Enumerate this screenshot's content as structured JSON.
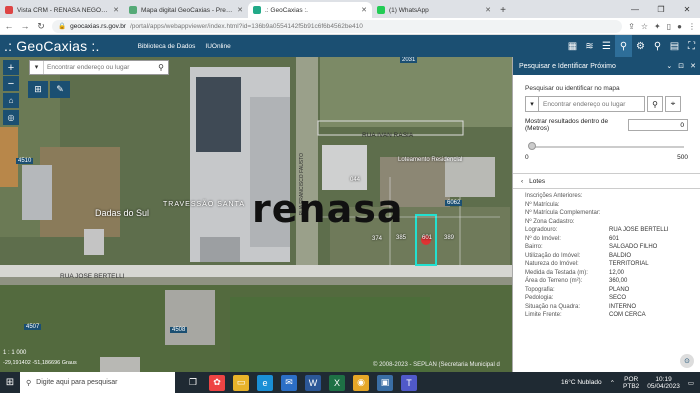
{
  "browser": {
    "tabs": [
      {
        "title": "Vista CRM - RENASA NEGÓCIOS",
        "favicon_color": "#d44",
        "active": false
      },
      {
        "title": "Mapa digital GeoCaxias - Prefeitu",
        "favicon_color": "#5a7",
        "active": false
      },
      {
        "title": ".: GeoCaxias :.",
        "favicon_color": "#2a8",
        "active": true
      },
      {
        "title": "(1) WhatsApp",
        "favicon_color": "#2c5",
        "active": false
      }
    ],
    "url_domain": "geocaxias.rs.gov.br",
    "url_path": "/portal/apps/webappviewer/index.html?id=136b9a0554142f5b91c6f6b4562be410",
    "new_tab": "+",
    "window_controls": [
      "—",
      "❐",
      "✕"
    ]
  },
  "app": {
    "logo": ".: GeoCaxias :.",
    "links": [
      "Biblioteca de Dados",
      "IUOnline"
    ],
    "tools": [
      "▦",
      "≋",
      "☰",
      "⚲",
      "⚙",
      "⚲",
      "▤",
      "⛶"
    ]
  },
  "map": {
    "search_placeholder": "Encontrar endereço ou lugar",
    "zoom_in": "+",
    "zoom_out": "−",
    "scale": "1 : 1 000",
    "coordinates": "-29,191402  -51,186696 Graus",
    "copyright": "© 2008-2023 - SEPLAN (Secretaria Municipal d",
    "street_labels": [
      "RUA IVAN RASIA",
      "RUA JOSE BERTELLI",
      "RUA FRANCISCO FAUSTO"
    ],
    "lot_numbers": [
      "2031",
      "4510",
      "6062",
      "4507",
      "4508"
    ],
    "area_labels": [
      "TRAVESSÃO SANTA",
      "Dadas do Sul"
    ],
    "watermark": "renasa",
    "parcel_labels": [
      "404",
      "044",
      "102",
      "Loteamento Residencial",
      "374",
      "601",
      "385",
      "389"
    ]
  },
  "panel": {
    "title": "Pesquisar e Identificar Próximo",
    "header_buttons": [
      "⌄",
      "⊡",
      "✕"
    ],
    "search_label": "Pesquisar ou identificar no mapa",
    "search_placeholder": "Encontrar endereço ou lugar",
    "distance_label": "Mostrar resultados dentro de (Metros)",
    "distance_value": "0",
    "slider_min": "0",
    "slider_max": "500",
    "results_title": "Lotes",
    "attributes": [
      {
        "key": "Inscrições Anteriores:",
        "value": ""
      },
      {
        "key": "Nº Matrícula:",
        "value": ""
      },
      {
        "key": "Nº Matrícula Complementar:",
        "value": ""
      },
      {
        "key": "Nº Zona Cadastro:",
        "value": ""
      },
      {
        "key": "Logradouro:",
        "value": "RUA JOSE BERTELLI"
      },
      {
        "key": "Nº do Imóvel:",
        "value": "601"
      },
      {
        "key": "Bairro:",
        "value": "SALGADO FILHO"
      },
      {
        "key": "Utilização do Imóvel:",
        "value": "BALDIO"
      },
      {
        "key": "Natureza do Imóvel:",
        "value": "TERRITORIAL"
      },
      {
        "key": "Medida da Testada (m):",
        "value": "12,00"
      },
      {
        "key": "Área do Terreno (m²):",
        "value": "360,00"
      },
      {
        "key": "Topografia:",
        "value": "PLANO"
      },
      {
        "key": "Pedologia:",
        "value": "SECO"
      },
      {
        "key": "Situação na Quadra:",
        "value": "INTERNO"
      },
      {
        "key": "Limite Frente:",
        "value": "COM CERCA"
      }
    ]
  },
  "taskbar": {
    "search_placeholder": "Digite aqui para pesquisar",
    "weather": "16°C  Nublado",
    "lang": "POR",
    "lang2": "PTB2",
    "time": "10:19",
    "date": "05/04/2023"
  }
}
